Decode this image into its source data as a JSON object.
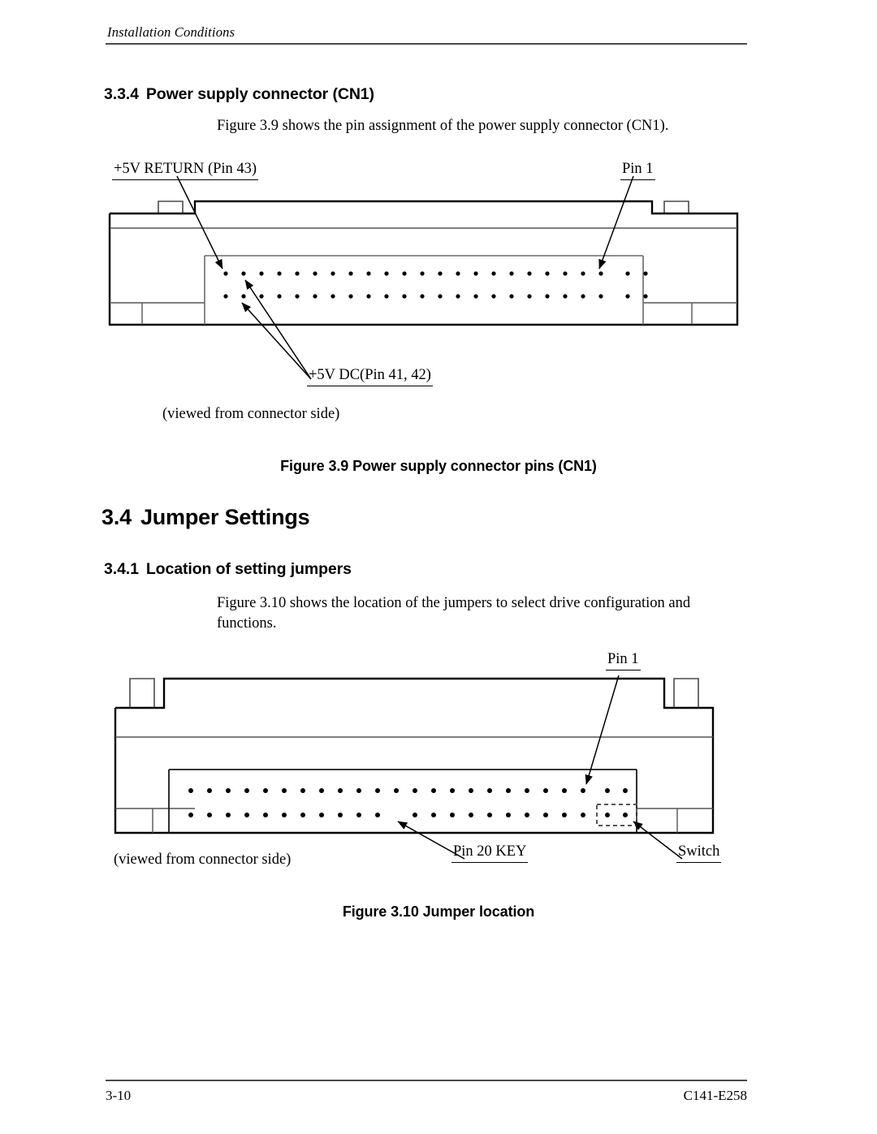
{
  "header": {
    "running_title": "Installation Conditions"
  },
  "sections": {
    "s334": {
      "number": "3.3.4",
      "title": "Power supply connector (CN1)",
      "body": "Figure 3.9 shows the pin assignment of the power supply connector (CN1)."
    },
    "s34": {
      "number": "3.4",
      "title": "Jumper Settings"
    },
    "s341": {
      "number": "3.4.1",
      "title": "Location of setting jumpers",
      "body": "Figure 3.10 shows the location of the jumpers to select drive configuration and functions."
    }
  },
  "figure_39": {
    "caption": "Figure 3.9  Power supply connector pins (CN1)",
    "note": "(viewed from connector side)",
    "callouts": {
      "return_5v": "+5V RETURN (Pin 43)",
      "pin1": "Pin 1",
      "dc_5v": "+5V DC(Pin 41, 42)"
    },
    "pins": {
      "main_group_columns": 22,
      "aux_group_columns": 2,
      "rows": 2,
      "missing_bottom_indexes": []
    }
  },
  "figure_310": {
    "caption": "Figure 3.10  Jumper location",
    "note": "(viewed from connector side)",
    "callouts": {
      "pin1": "Pin 1",
      "pin20key": "Pin 20 KEY",
      "switch": "Switch"
    },
    "pins": {
      "main_group_columns": 22,
      "aux_group_columns": 2,
      "rows": 2,
      "missing_bottom_indexes": [
        11
      ],
      "switch_box_columns": 2
    }
  },
  "footer": {
    "page_number": "3-10",
    "doc_number": "C141-E258"
  },
  "colors": {
    "ink": "#000000",
    "rule": "#4a4a4a",
    "thin_line": "#555555"
  }
}
